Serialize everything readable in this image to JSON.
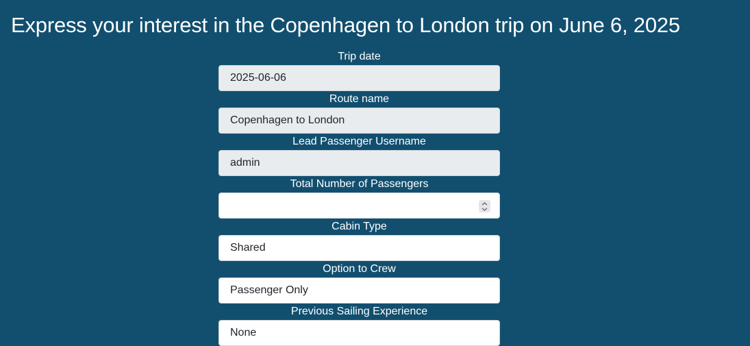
{
  "page": {
    "title": "Express your interest in the Copenhagen to London trip on June 6, 2025"
  },
  "form": {
    "trip_date": {
      "label": "Trip date",
      "value": "2025-06-06"
    },
    "route_name": {
      "label": "Route name",
      "value": "Copenhagen to London"
    },
    "lead_passenger": {
      "label": "Lead Passenger Username",
      "value": "admin"
    },
    "total_passengers": {
      "label": "Total Number of Passengers",
      "value": "",
      "stepper_icon": "chevron-up-down-icon"
    },
    "cabin_type": {
      "label": "Cabin Type",
      "value": "Shared"
    },
    "option_to_crew": {
      "label": "Option to Crew",
      "value": "Passenger Only"
    },
    "sailing_experience": {
      "label": "Previous Sailing Experience",
      "value": "None"
    }
  },
  "colors": {
    "background": "#124f6f",
    "readonly_field": "#e9ecef",
    "field": "#ffffff",
    "field_text": "#212529"
  }
}
